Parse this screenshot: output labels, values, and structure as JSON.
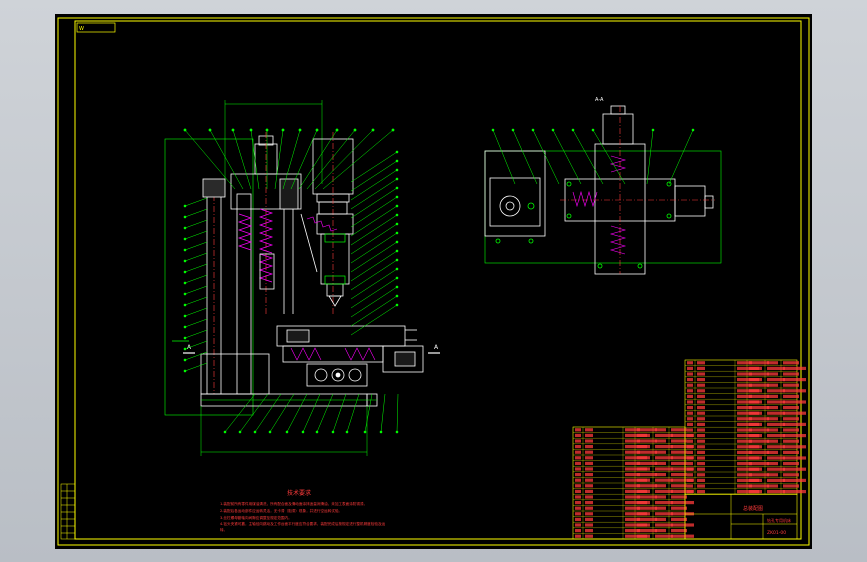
{
  "drawing": {
    "stamp_label": "W",
    "title_block_title": "总装配图",
    "title_block_subtitle": "钻孔专用机床",
    "drawing_number": "ZK01-00",
    "tech_requirements_title": "技术要求",
    "tech_requirements_lines": [
      "1.装配前所有零件用煤油清洗，所有配合面及滑动面涂抹适量润滑油，未加工表面涂防锈漆。",
      "2.装配后各运动部件应运转灵活，无卡滞（阻滞）现象，并进行空运转试验。",
      "3.丝杠螺母副轴向间隙应调整至规定范围内。",
      "4.钻头夹紧可靠，主轴径向跳动及工作台面平行度应符合要求，装配完成后按规定进行整机精度检验及运",
      "转。"
    ],
    "section_label_left": "A",
    "section_label_right": "A",
    "view_label": "A-A",
    "colors": {
      "sheet": "#000000",
      "line": "#ffffff",
      "border": "#ffff00",
      "leader": "#00ff00",
      "hatch": "#ff00ff",
      "red": "#ff3b3b"
    }
  }
}
